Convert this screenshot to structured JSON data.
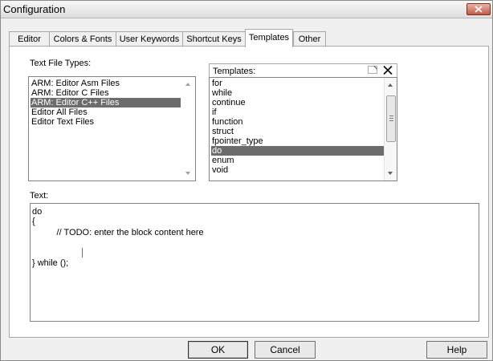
{
  "window": {
    "title": "Configuration"
  },
  "tabs": [
    {
      "label": "Editor",
      "active": false
    },
    {
      "label": "Colors & Fonts",
      "active": false
    },
    {
      "label": "User Keywords",
      "active": false
    },
    {
      "label": "Shortcut Keys",
      "active": false
    },
    {
      "label": "Templates",
      "active": true
    },
    {
      "label": "Other",
      "active": false
    }
  ],
  "file_types": {
    "label": "Text File Types:",
    "items": [
      "ARM: Editor Asm Files",
      "ARM: Editor C Files",
      "ARM: Editor C++ Files",
      "Editor All Files",
      "Editor Text Files"
    ],
    "selected": "ARM: Editor C++ Files"
  },
  "templates": {
    "label": "Templates:",
    "items": [
      "for",
      "while",
      "continue",
      "if",
      "function",
      "struct",
      "fpointer_type",
      "do",
      "enum",
      "void"
    ],
    "selected": "do",
    "new_icon": "new-template-icon",
    "delete_icon": "delete-template-icon"
  },
  "text": {
    "label": "Text:",
    "lines": [
      "do",
      "{",
      "          // TODO: enter the block content here",
      "",
      "} while ();"
    ]
  },
  "buttons": {
    "ok": "OK",
    "cancel": "Cancel",
    "help": "Help"
  },
  "colors": {
    "selection": "#6c6c6c",
    "dialog_bg": "#f0f0f0",
    "close_button": "#c45a45"
  }
}
